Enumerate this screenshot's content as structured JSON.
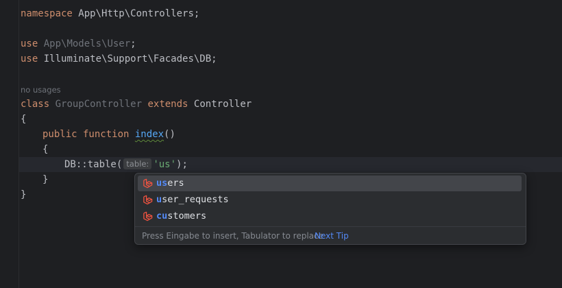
{
  "code": {
    "namespace_kw": "namespace",
    "namespace_name": "App\\Http\\Controllers;",
    "use1_kw": "use",
    "use1_path": "App\\Models\\User",
    "use1_end": ";",
    "use2_kw": "use",
    "use2_path": "Illuminate\\Support\\Facades\\DB;",
    "usage_hint": "no usages",
    "class_kw": "class",
    "class_name": "GroupController",
    "extends_kw": "extends",
    "parent_class": "Controller",
    "open_brace_class": "{",
    "public_kw": "public function",
    "method_name": "index",
    "method_parens": "()",
    "open_brace_method": "{",
    "db_call_prefix": "DB::table(",
    "param_hint": "table:",
    "string_value": "'us'",
    "db_call_suffix": ");",
    "close_brace_method": "}",
    "close_brace_class": "}"
  },
  "completion": {
    "items": [
      {
        "match": "us",
        "rest": "ers",
        "icon": "laravel-icon"
      },
      {
        "match": "u",
        "rest": "ser_requests",
        "icon": "laravel-icon"
      },
      {
        "match": "cu",
        "rest": "stomers",
        "icon": "laravel-icon",
        "match_split": [
          "c",
          "u",
          "s"
        ]
      }
    ],
    "item_labels": [
      "users",
      "user_requests",
      "customers"
    ],
    "footer_text": "Press Eingabe to insert, Tabulator to replace",
    "next_tip": "Next Tip"
  },
  "colors": {
    "background": "#1e1f22",
    "keyword": "#cf8e6d",
    "string": "#6aab73",
    "function": "#56a8f5",
    "match_highlight": "#548af7",
    "laravel_icon": "#f05340"
  }
}
